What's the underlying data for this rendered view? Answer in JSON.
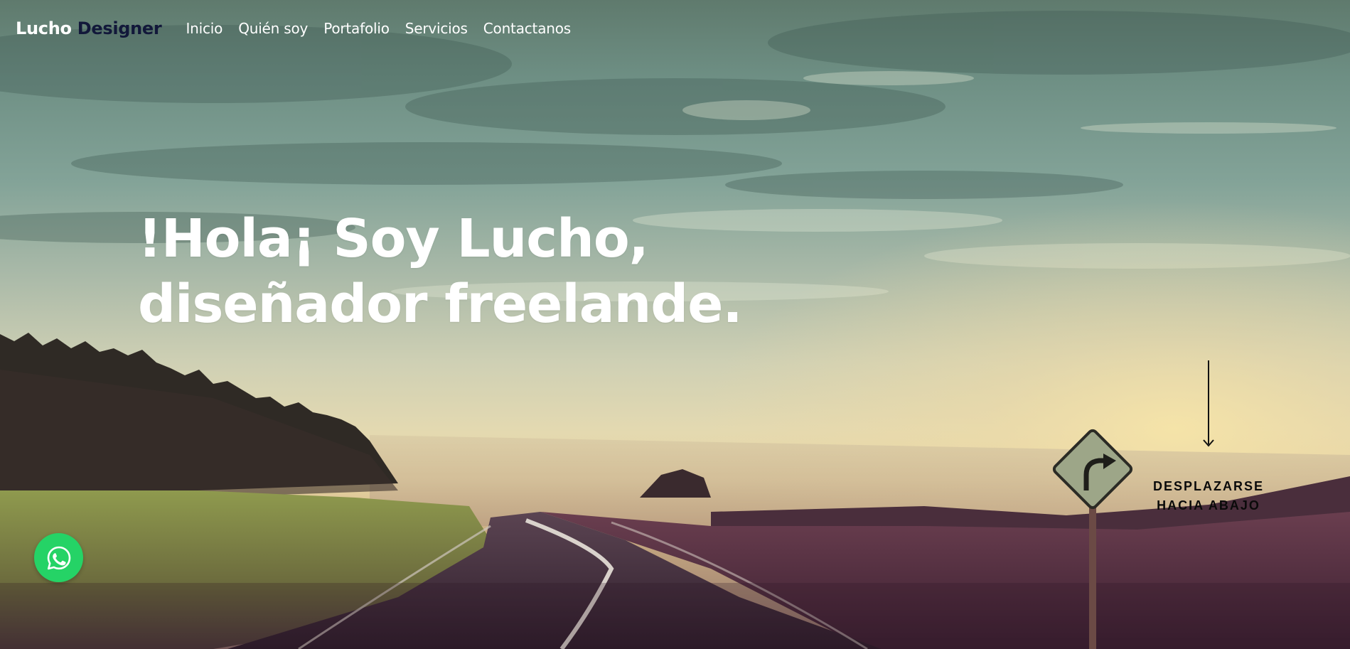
{
  "brand": {
    "first": "Lucho",
    "second": "Designer"
  },
  "nav": {
    "items": [
      {
        "label": "Inicio"
      },
      {
        "label": "Quién soy"
      },
      {
        "label": "Portafolio"
      },
      {
        "label": "Servicios"
      },
      {
        "label": "Contactanos"
      }
    ]
  },
  "hero": {
    "headline_line1": "!Hola¡ Soy Lucho,",
    "headline_line2": "diseñador freelande.",
    "scroll_line1": "DESPLAZARSE",
    "scroll_line2": "HACIA ABAJO"
  },
  "icons": {
    "scroll": "arrow-down-icon",
    "whatsapp": "whatsapp-icon"
  },
  "colors": {
    "brand_dark": "#12183a",
    "whatsapp_green": "#25d366",
    "text_white": "#ffffff"
  }
}
